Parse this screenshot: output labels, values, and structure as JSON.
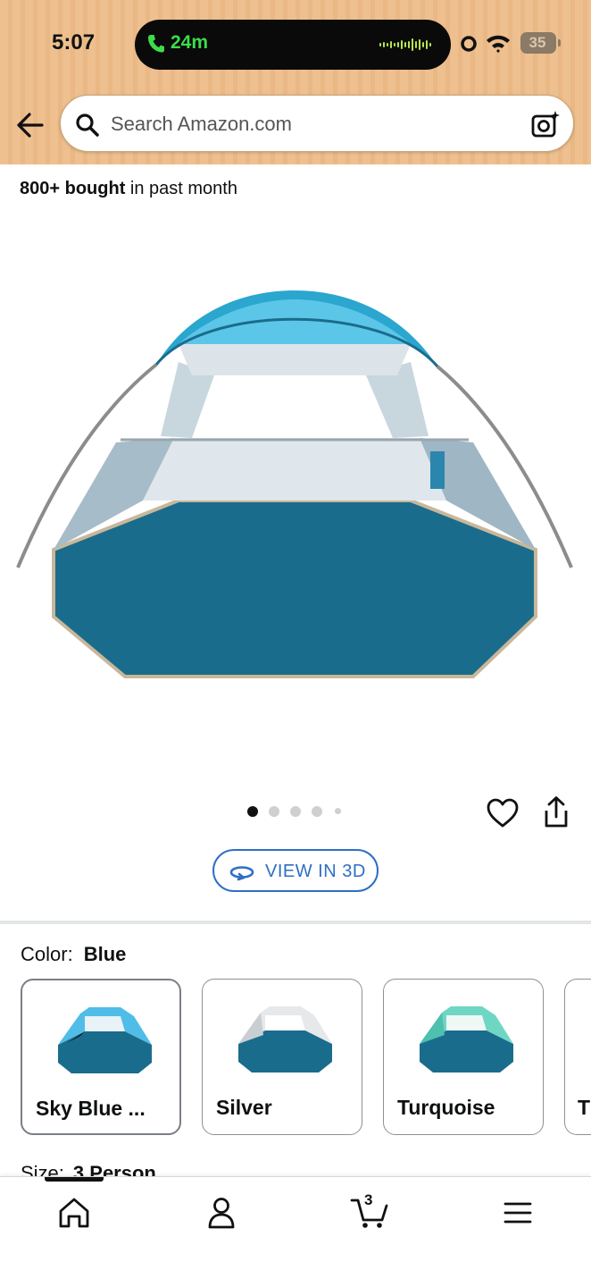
{
  "status_bar": {
    "time": "5:07",
    "call_duration": "24m",
    "battery_level": "35",
    "icons": [
      "phone-icon",
      "audio-wave-icon",
      "record-dot-icon",
      "wifi-icon",
      "battery-icon"
    ]
  },
  "header": {
    "back_icon": "arrow-left-icon",
    "search": {
      "placeholder": "Search Amazon.com",
      "value": ""
    },
    "camera_icon": "camera-search-icon",
    "background_color": "#eec08f"
  },
  "product": {
    "bought_count": "800+ bought",
    "bought_suffix": " in past month",
    "image_alt": "Blue beach tent",
    "image_carousel": {
      "total": 5,
      "current": 1
    },
    "view_3d_label": "VIEW IN 3D",
    "accent_color": "#2e6fc4"
  },
  "color_selector": {
    "label": "Color:",
    "selected": "Blue",
    "options": [
      {
        "label": "Sky Blue ...",
        "color": "#4fbde8"
      },
      {
        "label": "Silver",
        "color": "#e6e8ea"
      },
      {
        "label": "Turquoise",
        "color": "#6fd6c3"
      },
      {
        "label": "T",
        "color": "#cccccc"
      }
    ]
  },
  "size_selector": {
    "label": "Size:",
    "selected": "3 Person"
  },
  "bottom_nav": {
    "cart_count": "3",
    "items": [
      "home-icon",
      "account-icon",
      "cart-icon",
      "menu-icon"
    ]
  }
}
